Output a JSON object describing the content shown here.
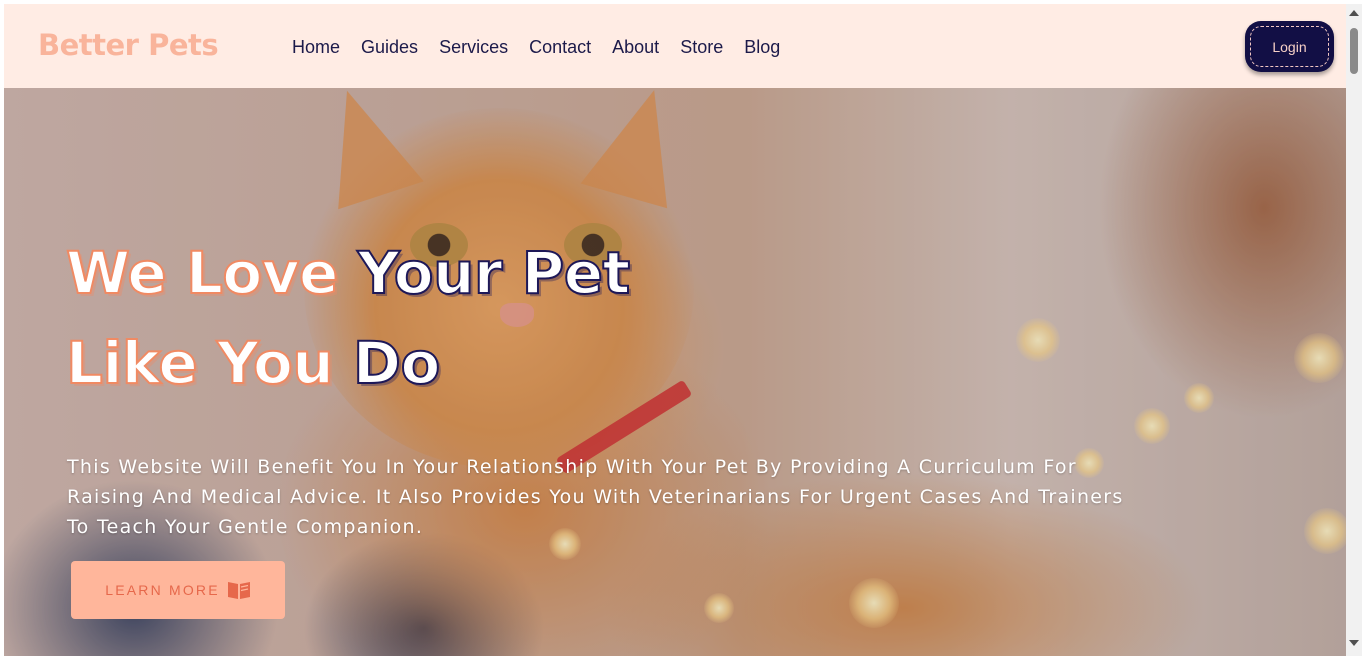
{
  "brand": {
    "name": "Better Pets"
  },
  "nav": {
    "items": [
      {
        "label": "Home"
      },
      {
        "label": "Guides"
      },
      {
        "label": "Services"
      },
      {
        "label": "Contact"
      },
      {
        "label": "About"
      },
      {
        "label": "Store"
      },
      {
        "label": "Blog"
      }
    ]
  },
  "login": {
    "label": "Login"
  },
  "hero": {
    "title_line1_part1": "We Love ",
    "title_line1_part2": "Your Pet",
    "title_line2_part1": "Like You ",
    "title_line2_part2": "Do",
    "description": "This Website Will Benefit You In Your Relationship With Your Pet By Providing A Curriculum For Raising And Medical Advice. It Also Provides You With Veterinarians For Urgent Cases And Trainers To Teach Your Gentle Companion.",
    "cta_label": "LEARN MORE",
    "cta_icon": "book-open-icon"
  },
  "colors": {
    "navbar_bg": "#ffece4",
    "brand": "#f9b49b",
    "nav_text": "#1c1a4a",
    "login_bg": "#120f45",
    "cta_bg": "#ffb69b",
    "cta_text": "#e6684b",
    "title_stroke_accent": "#f08a63",
    "title_stroke_dark": "#1d1858"
  }
}
